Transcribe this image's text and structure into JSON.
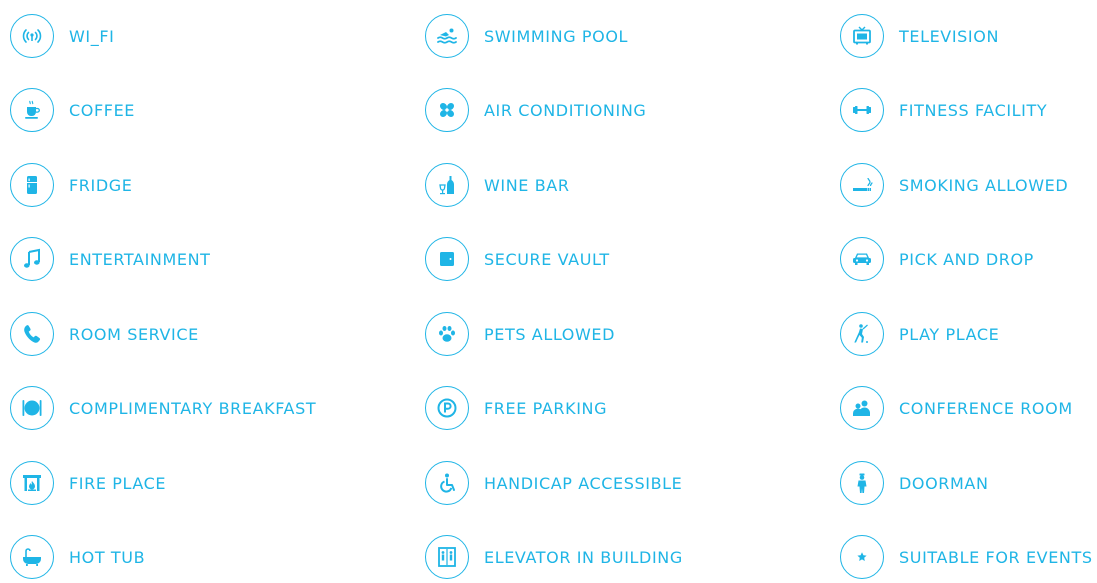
{
  "accent_color": "#1fb5e6",
  "columns": [
    {
      "items": [
        {
          "icon": "wifi-icon",
          "label": "WI_FI"
        },
        {
          "icon": "coffee-icon",
          "label": "COFFEE"
        },
        {
          "icon": "fridge-icon",
          "label": "FRIDGE"
        },
        {
          "icon": "music-note-icon",
          "label": "ENTERTAINMENT"
        },
        {
          "icon": "phone-icon",
          "label": "ROOM SERVICE"
        },
        {
          "icon": "plate-cutlery-icon",
          "label": "COMPLIMENTARY BREAKFAST"
        },
        {
          "icon": "fireplace-icon",
          "label": "FIRE PLACE"
        },
        {
          "icon": "bathtub-icon",
          "label": "HOT TUB"
        }
      ]
    },
    {
      "items": [
        {
          "icon": "swimming-icon",
          "label": "SWIMMING POOL"
        },
        {
          "icon": "fan-icon",
          "label": "AIR CONDITIONING"
        },
        {
          "icon": "wine-icon",
          "label": "WINE BAR"
        },
        {
          "icon": "safe-icon",
          "label": "SECURE VAULT"
        },
        {
          "icon": "paw-icon",
          "label": "PETS ALLOWED"
        },
        {
          "icon": "parking-icon",
          "label": "FREE PARKING"
        },
        {
          "icon": "wheelchair-icon",
          "label": "HANDICAP ACCESSIBLE"
        },
        {
          "icon": "elevator-icon",
          "label": "ELEVATOR IN BUILDING"
        }
      ]
    },
    {
      "items": [
        {
          "icon": "tv-icon",
          "label": "TELEVISION"
        },
        {
          "icon": "dumbbell-icon",
          "label": "FITNESS FACILITY"
        },
        {
          "icon": "cigarette-icon",
          "label": "SMOKING ALLOWED"
        },
        {
          "icon": "car-icon",
          "label": "PICK AND DROP"
        },
        {
          "icon": "golfer-icon",
          "label": "PLAY PLACE"
        },
        {
          "icon": "group-icon",
          "label": "CONFERENCE ROOM"
        },
        {
          "icon": "doorman-icon",
          "label": "DOORMAN"
        },
        {
          "icon": "star-icon",
          "label": "SUITABLE FOR EVENTS"
        }
      ]
    }
  ]
}
